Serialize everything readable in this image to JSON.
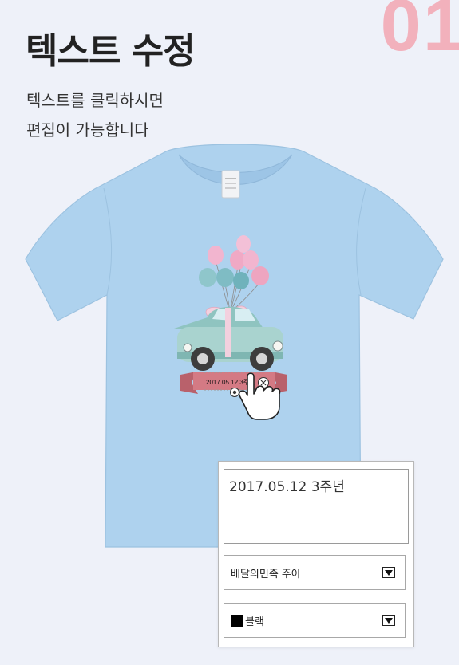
{
  "step": {
    "number": "01"
  },
  "title": "텍스트 수정",
  "description": {
    "line1": "텍스트를 클릭하시면",
    "line2": "편집이 가능합니다"
  },
  "design": {
    "banner_text": "2017.05.12 3주년",
    "shirt_color": "#aed2ee",
    "banner_color": "#d47a84",
    "car_color": "#a9d3cf"
  },
  "editor": {
    "text_value": "2017.05.12 3주년",
    "font_select": {
      "value": "배달의민족 주아"
    },
    "color_select": {
      "value": "블랙",
      "swatch": "#000000"
    }
  }
}
